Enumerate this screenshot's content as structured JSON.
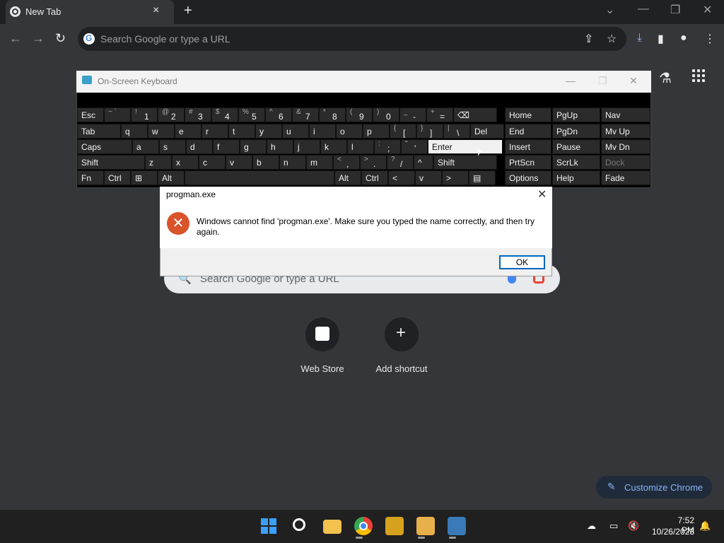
{
  "browser": {
    "tab_title": "New Tab",
    "omnibox_placeholder": "Search Google or type a URL"
  },
  "icons": {
    "tab_close": "×",
    "new_tab": "+",
    "chevron": "⌄",
    "minimize": "—",
    "restore": "❐",
    "close": "✕",
    "back": "←",
    "forward": "→",
    "reload": "↻",
    "share": "⇪",
    "star": "☆",
    "download": "⤓",
    "sidebar": "▮",
    "profile": "●",
    "menu": "⋮",
    "labs": "⚗",
    "search": "🔍",
    "plus": "+",
    "pencil": "✎",
    "error": "✕",
    "cursor": "➤"
  },
  "ntp": {
    "search_placeholder": "Search Google or type a URL",
    "tiles": [
      {
        "label": "Web Store"
      },
      {
        "label": "Add shortcut"
      }
    ],
    "customize_label": "Customize Chrome"
  },
  "osk": {
    "title": "On-Screen Keyboard",
    "rows": [
      [
        {
          "l": "Esc"
        },
        {
          "s": "~ `",
          "m": ""
        },
        {
          "s": "!",
          "m": "1"
        },
        {
          "s": "@",
          "m": "2"
        },
        {
          "s": "#",
          "m": "3"
        },
        {
          "s": "$",
          "m": "4"
        },
        {
          "s": "%",
          "m": "5"
        },
        {
          "s": "^",
          "m": "6"
        },
        {
          "s": "&",
          "m": "7"
        },
        {
          "s": "*",
          "m": "8"
        },
        {
          "s": "(",
          "m": "9"
        },
        {
          "s": ")",
          "m": "0"
        },
        {
          "s": "_",
          "m": "-"
        },
        {
          "s": "+",
          "m": "="
        },
        {
          "l": "⌫"
        }
      ],
      [
        {
          "l": "Tab"
        },
        {
          "l": "q"
        },
        {
          "l": "w"
        },
        {
          "l": "e"
        },
        {
          "l": "r"
        },
        {
          "l": "t"
        },
        {
          "l": "y"
        },
        {
          "l": "u"
        },
        {
          "l": "i"
        },
        {
          "l": "o"
        },
        {
          "l": "p"
        },
        {
          "s": "{",
          "m": "["
        },
        {
          "s": "}",
          "m": "]"
        },
        {
          "s": "|",
          "m": "\\"
        },
        {
          "l": "Del"
        }
      ],
      [
        {
          "l": "Caps"
        },
        {
          "l": "a"
        },
        {
          "l": "s"
        },
        {
          "l": "d"
        },
        {
          "l": "f"
        },
        {
          "l": "g"
        },
        {
          "l": "h"
        },
        {
          "l": "j"
        },
        {
          "l": "k"
        },
        {
          "l": "l"
        },
        {
          "s": ":",
          "m": ";"
        },
        {
          "s": "\"",
          "m": "'"
        },
        {
          "l": "Enter"
        }
      ],
      [
        {
          "l": "Shift"
        },
        {
          "l": "z"
        },
        {
          "l": "x"
        },
        {
          "l": "c"
        },
        {
          "l": "v"
        },
        {
          "l": "b"
        },
        {
          "l": "n"
        },
        {
          "l": "m"
        },
        {
          "s": "<",
          "m": ","
        },
        {
          "s": ">",
          "m": "."
        },
        {
          "s": "?",
          "m": "/"
        },
        {
          "l": "^"
        },
        {
          "l": "Shift"
        }
      ],
      [
        {
          "l": "Fn"
        },
        {
          "l": "Ctrl"
        },
        {
          "l": "⊞"
        },
        {
          "l": "Alt"
        },
        {
          "l": ""
        },
        {
          "l": "Alt"
        },
        {
          "l": "Ctrl"
        },
        {
          "l": "<"
        },
        {
          "l": "v"
        },
        {
          "l": ">"
        },
        {
          "l": "▤"
        }
      ]
    ],
    "nav_keys": [
      [
        "Home",
        "PgUp",
        "Nav"
      ],
      [
        "End",
        "PgDn",
        "Mv Up"
      ],
      [
        "Insert",
        "Pause",
        "Mv Dn"
      ],
      [
        "PrtScn",
        "ScrLk",
        "Dock"
      ],
      [
        "Options",
        "Help",
        "Fade"
      ]
    ]
  },
  "dialog": {
    "title": "progman.exe",
    "message": "Windows cannot find 'progman.exe'. Make sure you typed the name correctly, and then try again.",
    "ok_label": "OK"
  },
  "taskbar": {
    "time": "7:52 PM",
    "date": "10/26/2023"
  }
}
